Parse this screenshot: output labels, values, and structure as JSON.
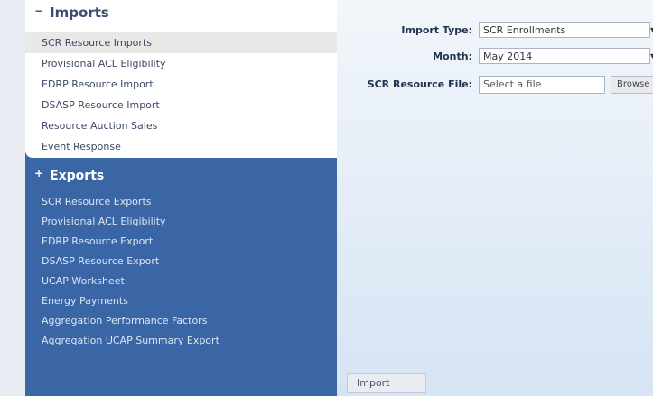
{
  "imports": {
    "heading": "Imports",
    "toggle": "−",
    "items": [
      {
        "label": "SCR Resource Imports"
      },
      {
        "label": "Provisional ACL Eligibility"
      },
      {
        "label": "EDRP Resource Import"
      },
      {
        "label": "DSASP Resource Import"
      },
      {
        "label": "Resource Auction Sales"
      },
      {
        "label": "Event Response"
      }
    ],
    "selected_index": 0
  },
  "exports": {
    "heading": "Exports",
    "toggle": "+",
    "items": [
      {
        "label": "SCR Resource Exports"
      },
      {
        "label": "Provisional ACL Eligibility"
      },
      {
        "label": "EDRP Resource Export"
      },
      {
        "label": "DSASP Resource Export"
      },
      {
        "label": "UCAP Worksheet"
      },
      {
        "label": "Energy Payments"
      },
      {
        "label": "Aggregation Performance Factors"
      },
      {
        "label": "Aggregation UCAP Summary Export"
      }
    ]
  },
  "form": {
    "import_type_label": "Import Type:",
    "import_type_value": "SCR Enrollments",
    "month_label": "Month:",
    "month_value": "May 2014",
    "file_label": "SCR Resource File:",
    "file_placeholder": "Select a file",
    "browse_label": "Browse",
    "chevron": "▾"
  },
  "import_button": "Import"
}
